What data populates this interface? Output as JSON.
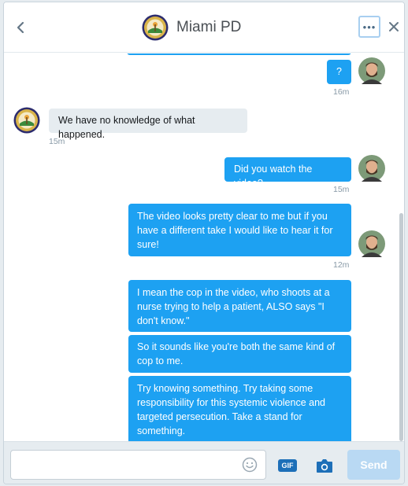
{
  "header": {
    "title": "Miami PD",
    "back_icon": "chevron-left-icon",
    "more_icon": "more-horizontal-icon",
    "more_label": "•••",
    "close_icon": "close-icon"
  },
  "messages": [
    {
      "text": "?",
      "time": "16m"
    },
    {
      "text": "We have no knowledge of what happened.",
      "time": "15m"
    },
    {
      "text": "Did you watch the video?",
      "time": "15m"
    },
    {
      "text": "The video looks pretty clear to me but if you have a different take I would like to hear it for sure!",
      "time": "12m"
    },
    {
      "text": "I mean the cop in the video, who shoots at a nurse trying to help a patient, ALSO says \"I don't know.\""
    },
    {
      "text": "So it sounds like you're both the same kind of cop to me."
    },
    {
      "text": "Try knowing something. Try taking some responsibility for this systemic violence and targeted persecution. Take a stand for something."
    }
  ],
  "composer": {
    "placeholder": "",
    "emoji_icon": "emoji-icon",
    "gif_label": "GIF",
    "camera_icon": "camera-icon",
    "send_label": "Send"
  },
  "colors": {
    "outgoing_bubble": "#1da1f2",
    "incoming_bubble": "#e6ecf0",
    "send_disabled": "#b9d9f3",
    "gif_badge": "#1d6fb8"
  }
}
